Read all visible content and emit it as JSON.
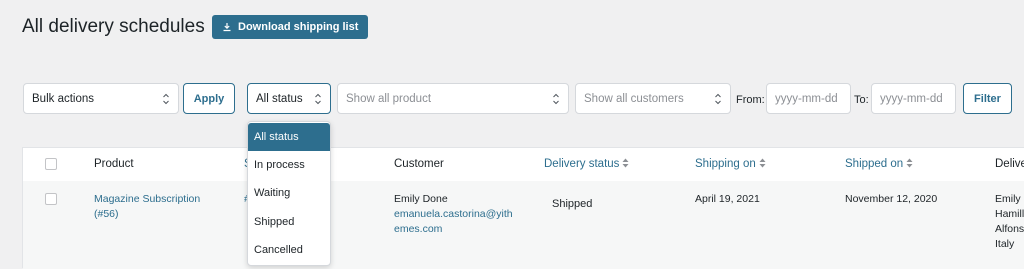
{
  "header": {
    "title": "All delivery schedules",
    "download_label": "Download shipping list"
  },
  "filters": {
    "bulk_actions": "Bulk actions",
    "apply_label": "Apply",
    "status_value": "All status",
    "product_placeholder": "Show all product",
    "customer_placeholder": "Show all customers",
    "from_label": "From:",
    "from_placeholder": "yyyy-mm-dd",
    "to_label": "To:",
    "to_placeholder": "yyyy-mm-dd",
    "filter_label": "Filter"
  },
  "status_dropdown": {
    "options": [
      "All status",
      "In process",
      "Waiting",
      "Shipped",
      "Cancelled"
    ],
    "selected": "All status"
  },
  "table": {
    "columns": {
      "product": "Product",
      "s_partial": "S",
      "customer": "Customer",
      "delivery_status": "Delivery status",
      "shipping_on": "Shipping on",
      "shipped_on": "Shipped on",
      "delivery_partial": "Delive"
    },
    "rows": [
      {
        "product_line1": "Magazine Subscription",
        "product_line2": "(#56)",
        "s_partial": "#",
        "customer_name": "Emily Done",
        "customer_email_line1": "emanuela.castorina@yith",
        "customer_email_line2": "emes.com",
        "delivery_status": "Shipped",
        "shipping_on": "April 19, 2021",
        "shipped_on": "November 12, 2020",
        "delivery_line1": "Emily I",
        "delivery_line2": "Hamill",
        "delivery_line3": "Alfons",
        "delivery_line4": "Italy"
      }
    ]
  },
  "colors": {
    "accent": "#2d6e8e",
    "background": "#f0f0f1"
  }
}
